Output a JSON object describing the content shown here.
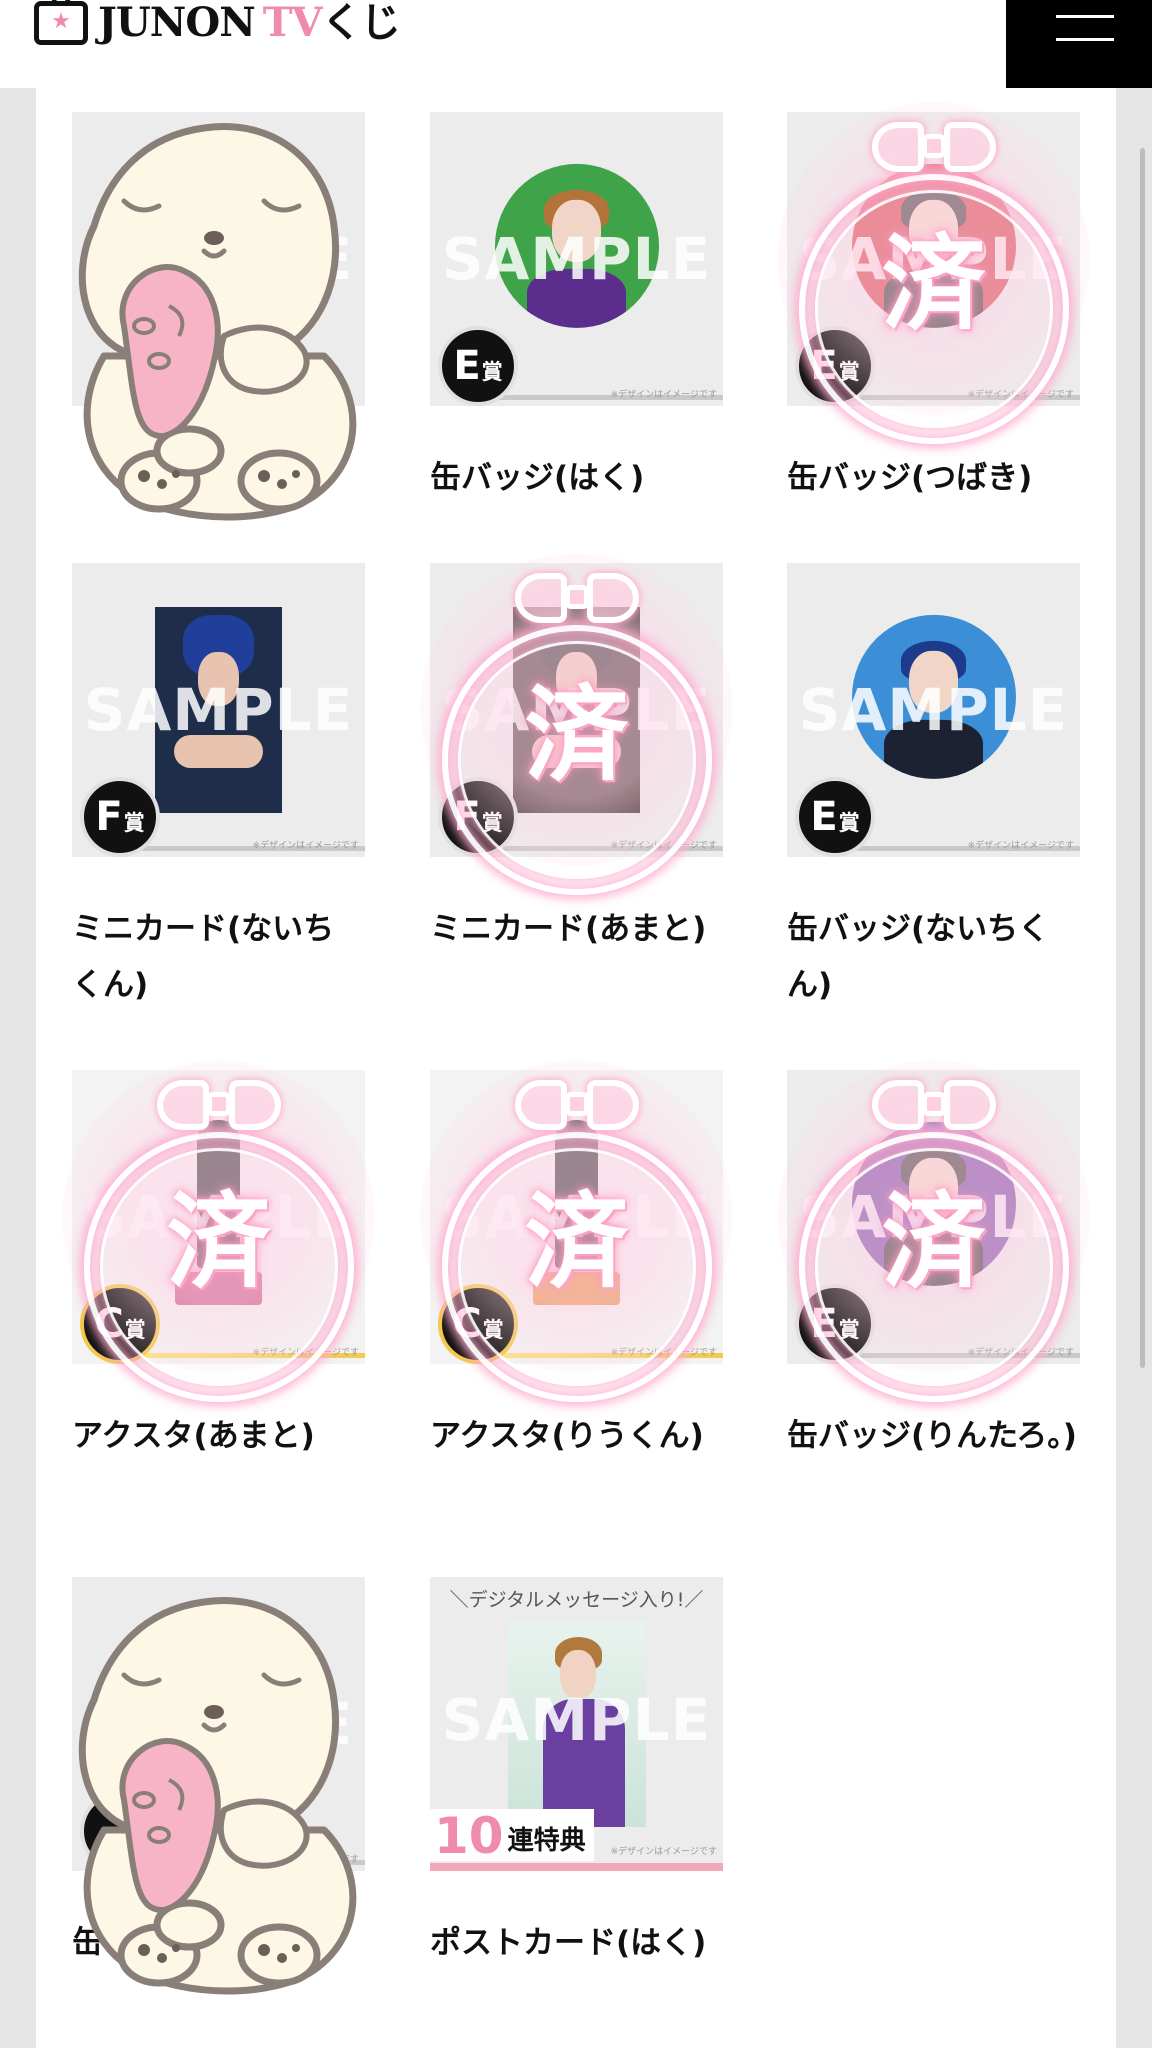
{
  "header": {
    "logo": {
      "brand": "JUNON",
      "tv": "TV",
      "kuji": "くじ"
    }
  },
  "items": [
    {
      "id": "r1c1",
      "title": "",
      "rank": "",
      "sumi": false,
      "dog": true
    },
    {
      "id": "r1c2",
      "title": "缶バッジ(はく)",
      "rank": "E",
      "sumi": false,
      "type": "badge",
      "colors": {
        "bg": "#3fa349",
        "shirt": "#5b2d8c",
        "hair": "#b3743a"
      }
    },
    {
      "id": "r1c3",
      "title": "缶バッジ(つばき)",
      "rank": "E",
      "sumi": true,
      "type": "badge",
      "colors": {
        "bg": "#d1343a",
        "shirt": "#222222",
        "hair": "#2b2b2b"
      }
    },
    {
      "id": "r2c1",
      "title": "ミニカード(ないちくん)",
      "rank": "F",
      "sumi": false,
      "type": "card"
    },
    {
      "id": "r2c2",
      "title": "ミニカード(あまと)",
      "rank": "F",
      "sumi": true,
      "type": "card"
    },
    {
      "id": "r2c3",
      "title": "缶バッジ(ないちくん)",
      "rank": "E",
      "sumi": false,
      "type": "badge",
      "colors": {
        "bg": "#3c8fd6",
        "shirt": "#1d2233",
        "hair": "#1e3a8c"
      }
    },
    {
      "id": "r3c1",
      "title": "アクスタ(あまと)",
      "rank": "C",
      "sumi": true,
      "type": "acsta",
      "colors": {
        "base": "#c2477a"
      }
    },
    {
      "id": "r3c2",
      "title": "アクスタ(りうくん)",
      "rank": "C",
      "sumi": true,
      "type": "acsta",
      "colors": {
        "base": "#e48a3a"
      }
    },
    {
      "id": "r3c3",
      "title": "缶バッジ(りんたろ。)",
      "rank": "E",
      "sumi": true,
      "type": "badge",
      "colors": {
        "bg": "#6a3aa0",
        "shirt": "#222222",
        "hair": "#2b2b2b"
      }
    },
    {
      "id": "r4c1",
      "title": "缶",
      "rank": "",
      "sumi": false,
      "dog": true
    },
    {
      "id": "r4c2",
      "title": "ポストカード(はく)",
      "rank": "",
      "sumi": false,
      "type": "postcard"
    }
  ],
  "labels": {
    "sample": "SAMPLE",
    "note": "※デザインはイメージです",
    "prize_suffix": "賞",
    "sumi": "済",
    "digital_message": "＼デジタルメッセージ入り!／",
    "bonus_number": "10",
    "bonus_text": "連特典"
  }
}
